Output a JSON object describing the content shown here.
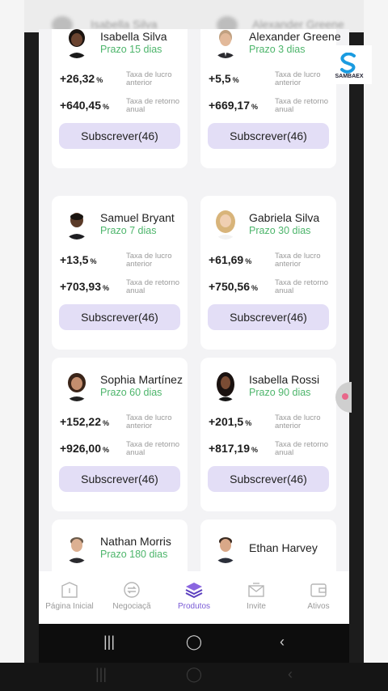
{
  "background": {
    "ghost_names": [
      "Isabella Silva",
      "Alexander Greene"
    ]
  },
  "logo": {
    "name": "SAMBAEX",
    "icon": "s-logo-icon",
    "color": "#1a9be0"
  },
  "subscribe_label": "Subscrever(46)",
  "labels": {
    "prev_profit": "Taxa de lucro anterior",
    "annual_return": "Taxa de retorno anual",
    "pct": "%"
  },
  "cards": [
    {
      "name": "Isabella Silva",
      "term": "Prazo 15 dias",
      "profit": "+26,32",
      "annual": "+640,45",
      "subscribe": "Subscrever(46)"
    },
    {
      "name": "Alexander Greene",
      "term": "Prazo 3 dias",
      "profit": "+5,5",
      "annual": "+669,17",
      "subscribe": "Subscrever(46)"
    },
    {
      "name": "Samuel Bryant",
      "term": "Prazo 7 dias",
      "profit": "+13,5",
      "annual": "+703,93",
      "subscribe": "Subscrever(46)"
    },
    {
      "name": "Gabriela Silva",
      "term": "Prazo 30 dias",
      "profit": "+61,69",
      "annual": "+750,56",
      "subscribe": "Subscrever(46)"
    },
    {
      "name": "Sophia Martínez",
      "term": "Prazo 60 dias",
      "profit": "+152,22",
      "annual": "+926,00",
      "subscribe": "Subscrever(46)"
    },
    {
      "name": "Isabella Rossi",
      "term": "Prazo 90 dias",
      "profit": "+201,5",
      "annual": "+817,19",
      "subscribe": "Subscrever(46)"
    },
    {
      "name": "Nathan Morris",
      "term": "Prazo 180 dias"
    },
    {
      "name": "Ethan Harvey"
    }
  ],
  "tabs": [
    {
      "label": "Página Inicial",
      "icon": "home-icon"
    },
    {
      "label": "Negociaçã",
      "icon": "exchange-icon"
    },
    {
      "label": "Produtos",
      "icon": "layers-icon",
      "active": true
    },
    {
      "label": "Invite",
      "icon": "envelope-icon"
    },
    {
      "label": "Ativos",
      "icon": "wallet-icon"
    }
  ],
  "overlay_caption": "Produtos",
  "colors": {
    "accent": "#7a5bd6",
    "term_green": "#4db56b",
    "button_bg": "#e3def6"
  }
}
